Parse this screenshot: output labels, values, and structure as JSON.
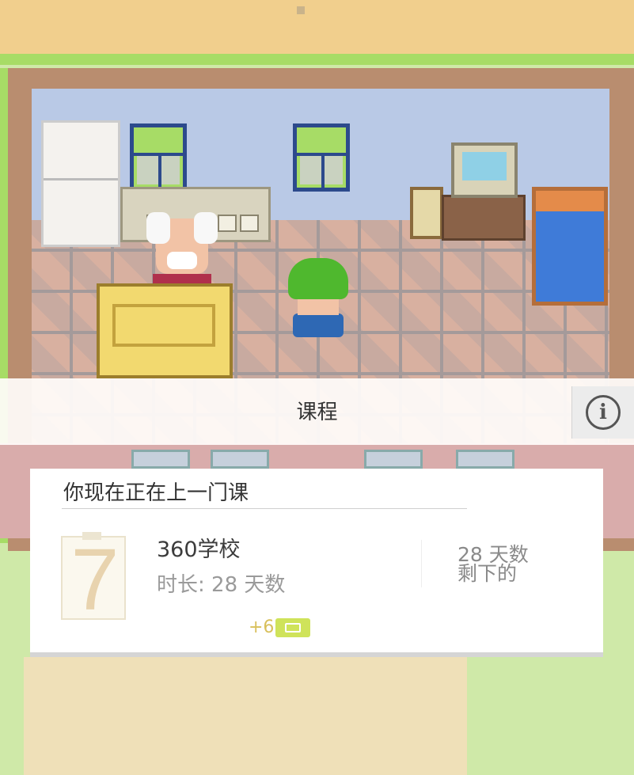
{
  "header": {
    "title": "课程",
    "info_icon": "info-icon"
  },
  "course_card": {
    "heading": "你现在正在上一门课",
    "calendar_icon": "calendar-day-7-icon",
    "calendar_day": "7",
    "course_name": "360学校",
    "duration": "时长: 28 天数",
    "remaining_days": "28 天数",
    "remaining_label": "剩下的",
    "reward_text": "+6",
    "reward_icon": "energy-badge-icon"
  },
  "colors": {
    "header_bg": "#fffcfa",
    "card_bg": "#ffffff",
    "reward": "#d8c05c",
    "reward_badge": "#cfe35a"
  }
}
